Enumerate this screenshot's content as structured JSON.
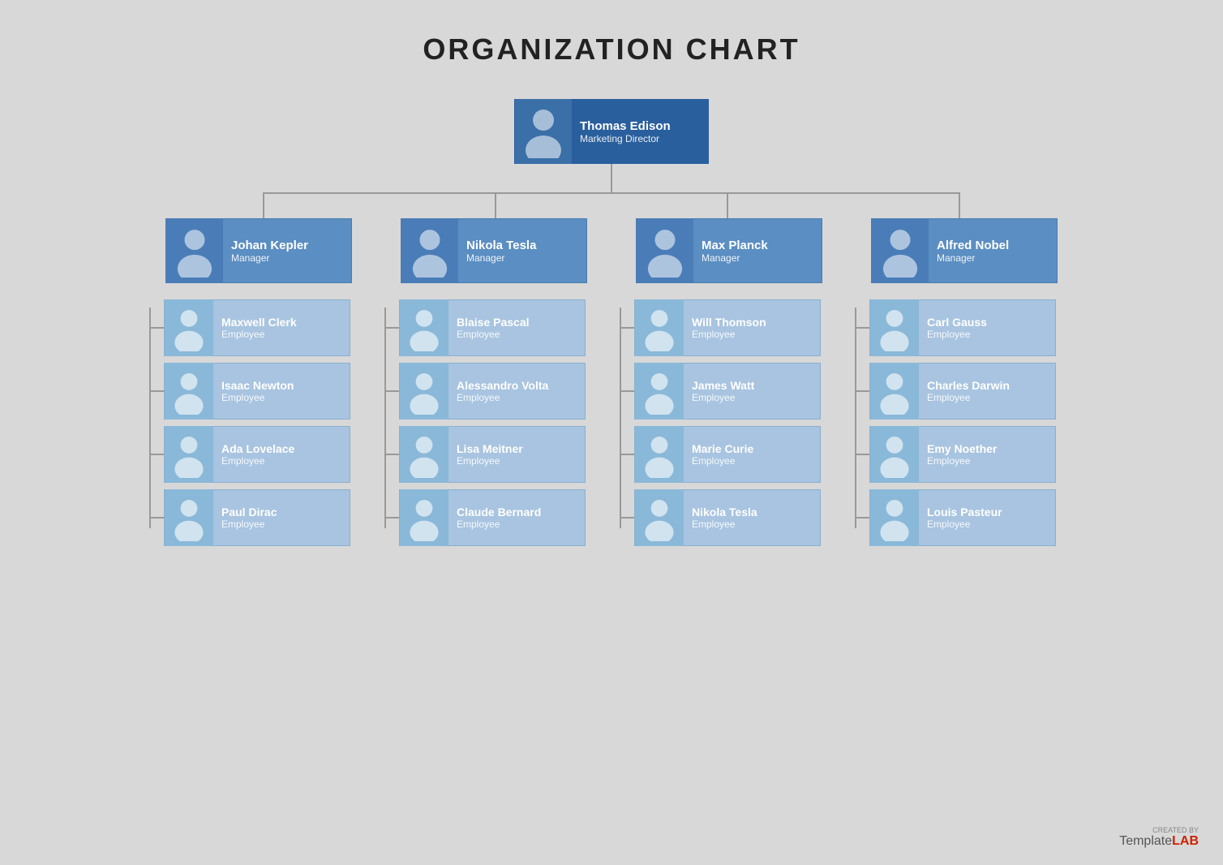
{
  "title": "ORGANIZATION CHART",
  "ceo": {
    "name": "Thomas Edison",
    "role": "Marketing Director"
  },
  "managers": [
    {
      "name": "Johan Kepler",
      "role": "Manager"
    },
    {
      "name": "Nikola Tesla",
      "role": "Manager"
    },
    {
      "name": "Max Planck",
      "role": "Manager"
    },
    {
      "name": "Alfred Nobel",
      "role": "Manager"
    }
  ],
  "employees": [
    [
      {
        "name": "Maxwell Clerk",
        "role": "Employee"
      },
      {
        "name": "Isaac Newton",
        "role": "Employee"
      },
      {
        "name": "Ada Lovelace",
        "role": "Employee"
      },
      {
        "name": "Paul Dirac",
        "role": "Employee"
      }
    ],
    [
      {
        "name": "Blaise Pascal",
        "role": "Employee"
      },
      {
        "name": "Alessandro Volta",
        "role": "Employee"
      },
      {
        "name": "Lisa Meitner",
        "role": "Employee"
      },
      {
        "name": "Claude Bernard",
        "role": "Employee"
      }
    ],
    [
      {
        "name": "Will Thomson",
        "role": "Employee"
      },
      {
        "name": "James Watt",
        "role": "Employee"
      },
      {
        "name": "Marie Curie",
        "role": "Employee"
      },
      {
        "name": "Nikola Tesla",
        "role": "Employee"
      }
    ],
    [
      {
        "name": "Carl Gauss",
        "role": "Employee"
      },
      {
        "name": "Charles Darwin",
        "role": "Employee"
      },
      {
        "name": "Emy Noether",
        "role": "Employee"
      },
      {
        "name": "Louis Pasteur",
        "role": "Employee"
      }
    ]
  ],
  "footer": {
    "created_by": "CREATED BY",
    "brand_template": "Template",
    "brand_lab": "LAB"
  }
}
